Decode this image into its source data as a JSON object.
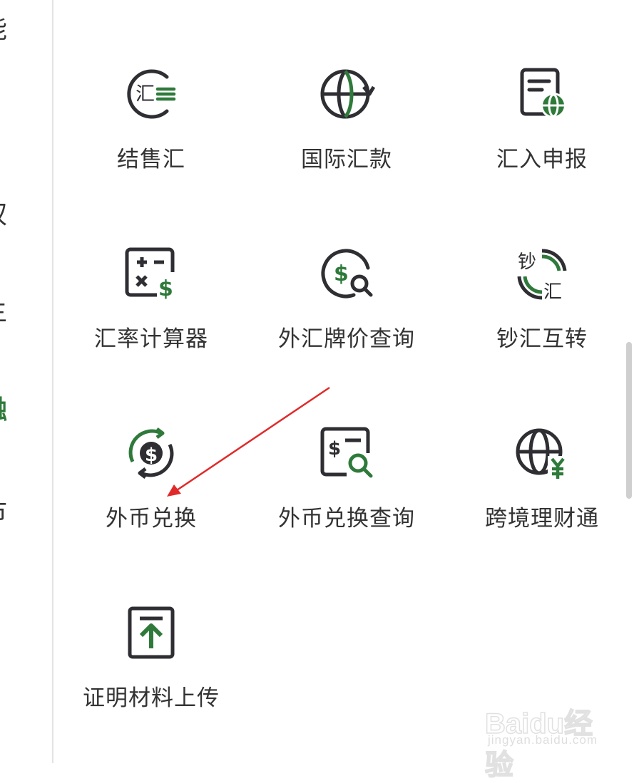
{
  "sidebar": {
    "items": [
      {
        "label": "能",
        "active": false
      },
      {
        "label": "权",
        "active": false
      },
      {
        "label": "主",
        "active": false
      },
      {
        "label": "融",
        "active": true
      },
      {
        "label": "市",
        "active": false
      }
    ]
  },
  "tiles": [
    {
      "label": "结售汇",
      "icon": "fx-settlement-icon"
    },
    {
      "label": "国际汇款",
      "icon": "globe-transfer-icon"
    },
    {
      "label": "汇入申报",
      "icon": "document-globe-icon"
    },
    {
      "label": "汇率计算器",
      "icon": "calculator-dollar-icon"
    },
    {
      "label": "外汇牌价查询",
      "icon": "dollar-search-icon"
    },
    {
      "label": "钞汇互转",
      "icon": "cash-remit-exchange-icon"
    },
    {
      "label": "外币兑换",
      "icon": "dollar-exchange-icon"
    },
    {
      "label": "外币兑换查询",
      "icon": "dollar-document-search-icon"
    },
    {
      "label": "跨境理财通",
      "icon": "globe-yuan-icon"
    },
    {
      "label": "证明材料上传",
      "icon": "upload-icon"
    }
  ],
  "icon_text": {
    "hui": "汇",
    "chao": "钞"
  },
  "colors": {
    "dark": "#2e2e33",
    "green": "#2f7a3b",
    "annotation": "#e02a2a"
  },
  "watermark": {
    "logo": "Baidu经验",
    "sub": "jingyan.baidu.com"
  }
}
